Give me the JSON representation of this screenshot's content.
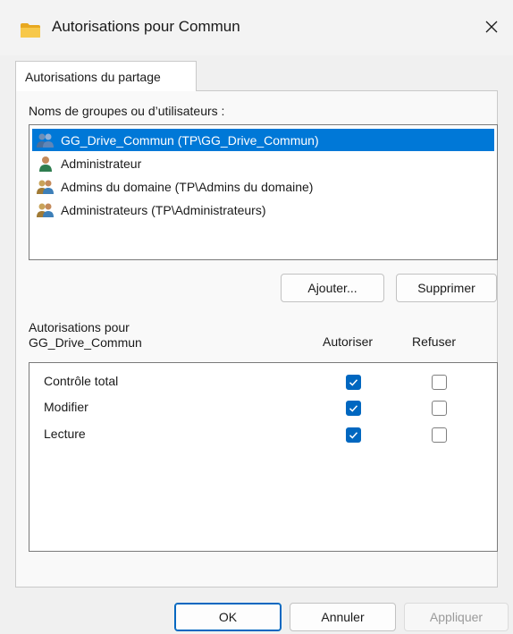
{
  "window": {
    "title": "Autorisations pour Commun",
    "icon": "folder-icon"
  },
  "tabs": [
    {
      "label": "Autorisations du partage",
      "active": true
    }
  ],
  "groups_section": {
    "label": "Noms de groupes ou d’utilisateurs :",
    "items": [
      {
        "label": "GG_Drive_Commun (TP\\GG_Drive_Commun)",
        "icon": "group-users-icon",
        "selected": true
      },
      {
        "label": "Administrateur",
        "icon": "user-icon",
        "selected": false
      },
      {
        "label": "Admins du domaine (TP\\Admins du domaine)",
        "icon": "group-users-icon",
        "selected": false
      },
      {
        "label": "Administrateurs (TP\\Administrateurs)",
        "icon": "group-users-icon",
        "selected": false
      }
    ],
    "add_label": "Ajouter...",
    "remove_label": "Supprimer"
  },
  "permissions_section": {
    "label_line1": "Autorisations pour",
    "label_line2": "GG_Drive_Commun",
    "col_allow": "Autoriser",
    "col_deny": "Refuser",
    "rows": [
      {
        "name": "Contrôle total",
        "allow": true,
        "deny": false
      },
      {
        "name": "Modifier",
        "allow": true,
        "deny": false
      },
      {
        "name": "Lecture",
        "allow": true,
        "deny": false
      }
    ]
  },
  "footer": {
    "ok_label": "OK",
    "cancel_label": "Annuler",
    "apply_label": "Appliquer",
    "apply_enabled": false
  },
  "colors": {
    "accent": "#0078d7",
    "checkbox": "#0067c0",
    "folder": "#f5c242"
  }
}
